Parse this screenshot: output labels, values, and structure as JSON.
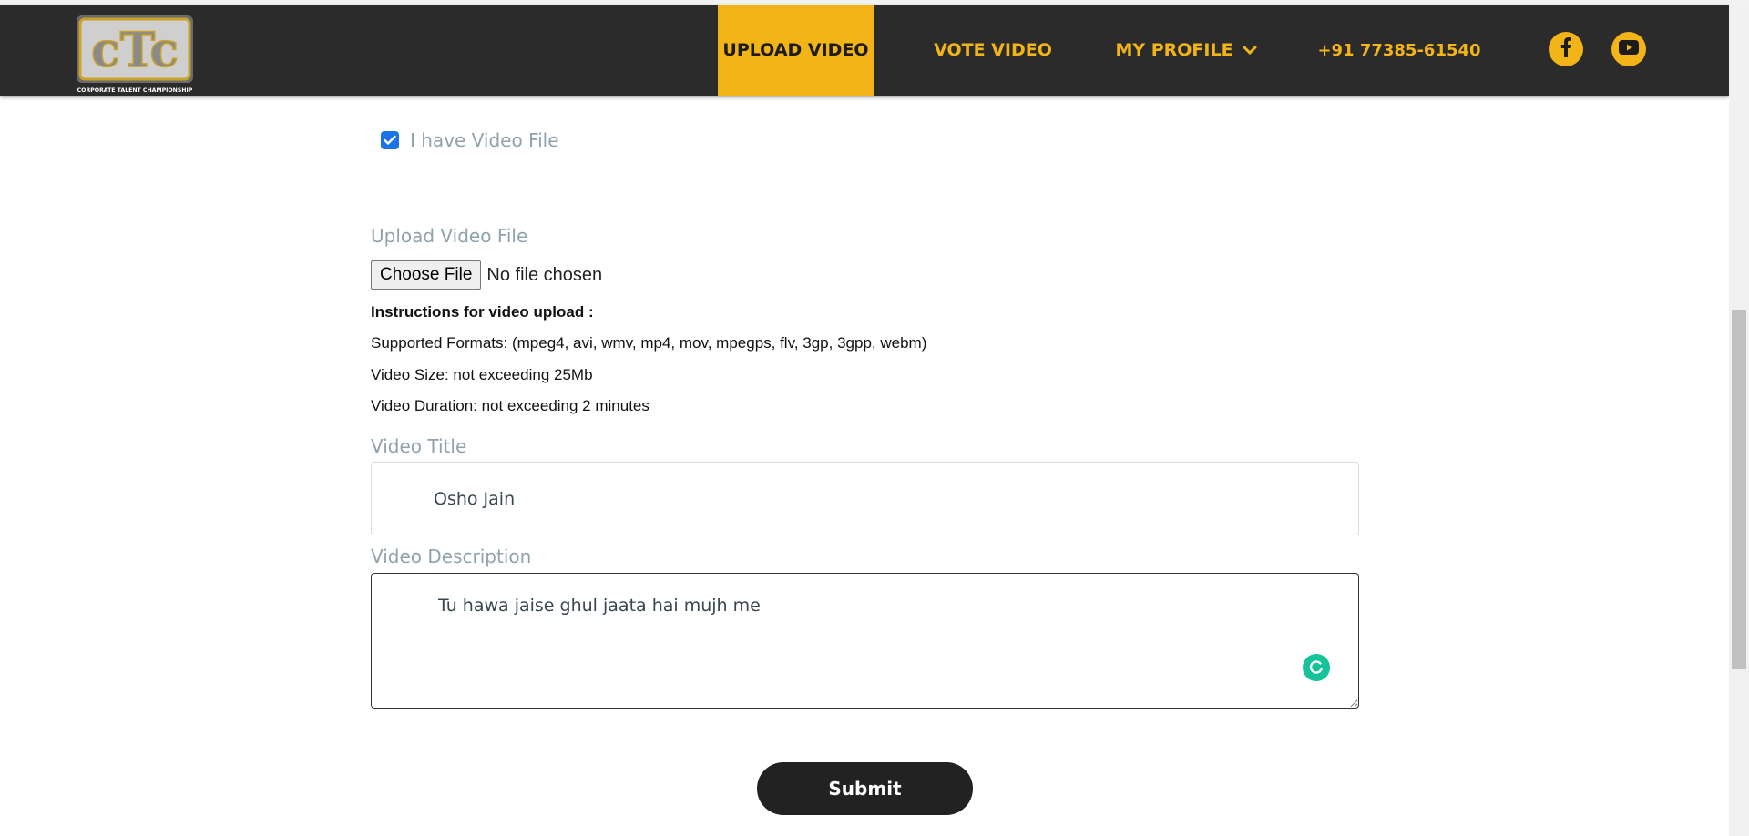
{
  "logo": {
    "letters": "cTc",
    "tagline": "CORPORATE TALENT CHAMPIONSHIP"
  },
  "nav": {
    "upload_video": "UPLOAD VIDEO",
    "vote_video": "VOTE VIDEO",
    "my_profile": "MY PROFILE",
    "phone": "+91 77385-61540"
  },
  "social": {
    "facebook_icon": "facebook-icon",
    "youtube_icon": "youtube-icon"
  },
  "form": {
    "checkbox_label": "I have Video File",
    "checkbox_checked": true,
    "upload_label": "Upload Video File",
    "choose_file_button": "Choose File",
    "no_file_text": "No file chosen",
    "instructions": {
      "title": "Instructions for video upload :",
      "formats": "Supported Formats: (mpeg4, avi, wmv, mp4, mov, mpegps, flv, 3gp, 3gpp, webm)",
      "size": "Video Size: not exceeding 25Mb",
      "duration": "Video Duration: not exceeding 2 minutes"
    },
    "video_title_label": "Video Title",
    "video_title_value": "Osho Jain",
    "video_description_label": "Video Description",
    "video_description_value": "Tu hawa jaise ghul jaata hai mujh me",
    "submit_label": "Submit"
  },
  "colors": {
    "accent": "#f2b416",
    "header_bg": "#2b2b2b",
    "checkbox": "#1a73e8",
    "grammar": "#15c39a"
  }
}
